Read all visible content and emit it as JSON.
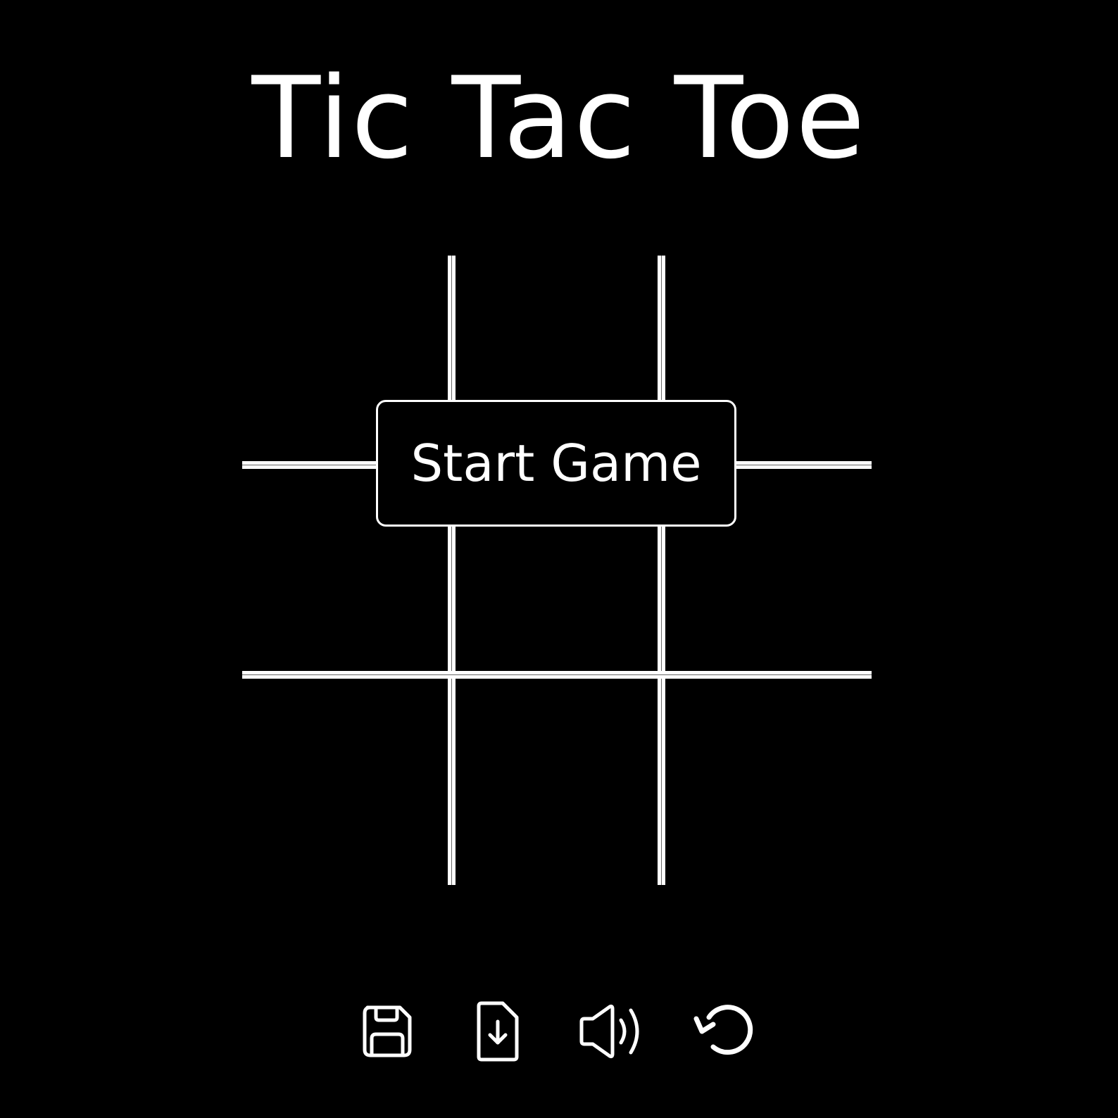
{
  "title": "Tic Tac Toe",
  "board": {
    "rows": 3,
    "columns": 3,
    "cells": [
      "",
      "",
      "",
      "",
      "",
      "",
      "",
      "",
      ""
    ]
  },
  "start_button": {
    "label": "Start Game"
  },
  "toolbar": {
    "items": [
      {
        "icon": "save-icon"
      },
      {
        "icon": "load-file-icon"
      },
      {
        "icon": "sound-icon"
      },
      {
        "icon": "restart-icon"
      }
    ]
  },
  "colors": {
    "background": "#000000",
    "foreground": "#ffffff"
  }
}
